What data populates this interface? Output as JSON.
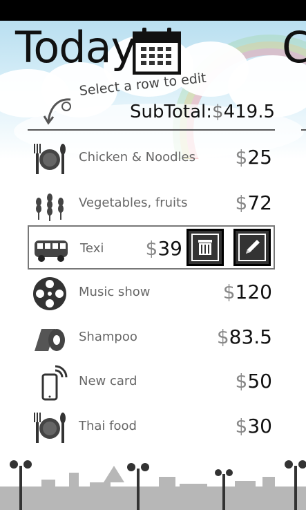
{
  "page": {
    "title": "Today",
    "next_title": "C"
  },
  "hint": "Select a row to edit",
  "subtotal": {
    "label": "SubTotal:",
    "currency": "$",
    "value": "419.5"
  },
  "rows": [
    {
      "name": "Chicken & Noodles",
      "currency": "$",
      "amount": "25",
      "icon": "dining-icon"
    },
    {
      "name": "Vegetables, fruits",
      "currency": "$",
      "amount": "72",
      "icon": "wheat-icon"
    },
    {
      "name": "Texi",
      "currency": "$",
      "amount": "39",
      "icon": "bus-icon",
      "selected": true
    },
    {
      "name": "Music show",
      "currency": "$",
      "amount": "120",
      "icon": "film-reel-icon"
    },
    {
      "name": "Shampoo",
      "currency": "$",
      "amount": "83.5",
      "icon": "toilet-paper-icon"
    },
    {
      "name": "New card",
      "currency": "$",
      "amount": "50",
      "icon": "phone-icon"
    },
    {
      "name": "Thai food",
      "currency": "$",
      "amount": "30",
      "icon": "dining-icon"
    }
  ],
  "actions": {
    "delete_icon": "trash-icon",
    "edit_icon": "pencil-icon"
  },
  "colors": {
    "sky": "#b9dff0",
    "text": "#111111",
    "muted": "#666666"
  }
}
